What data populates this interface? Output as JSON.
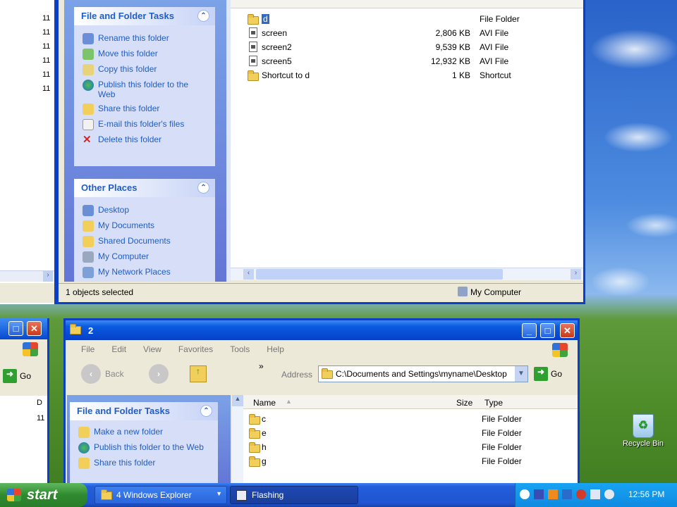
{
  "top_window": {
    "task_pane": {
      "file_folder_tasks": {
        "title": "File and Folder Tasks",
        "items": [
          "Rename this folder",
          "Move this folder",
          "Copy this folder",
          "Publish this folder to the Web",
          "Share this folder",
          "E-mail this folder's files",
          "Delete this folder"
        ]
      },
      "other_places": {
        "title": "Other Places",
        "items": [
          "Desktop",
          "My Documents",
          "Shared Documents",
          "My Computer",
          "My Network Places"
        ]
      }
    },
    "files": [
      {
        "name": "d",
        "size": "",
        "type": "File Folder",
        "icon": "folder-icon",
        "selected": true
      },
      {
        "name": "screen",
        "size": "2,806 KB",
        "type": "AVI File",
        "icon": "avi-file-icon"
      },
      {
        "name": "screen2",
        "size": "9,539 KB",
        "type": "AVI File",
        "icon": "avi-file-icon"
      },
      {
        "name": "screen5",
        "size": "12,932 KB",
        "type": "AVI File",
        "icon": "avi-file-icon"
      },
      {
        "name": "Shortcut to d",
        "size": "1 KB",
        "type": "Shortcut",
        "icon": "shortcut-icon"
      }
    ],
    "status_left": "1 objects selected",
    "status_right": "My Computer"
  },
  "left_window": {
    "numbers": [
      "11",
      "11",
      "11",
      "11",
      "11",
      "11"
    ],
    "go_label": "Go",
    "column_header": "D",
    "row_number": "11"
  },
  "bottom_window": {
    "title": "2",
    "menu": [
      "File",
      "Edit",
      "View",
      "Favorites",
      "Tools",
      "Help"
    ],
    "toolbar": {
      "back": "Back",
      "chevron": "»"
    },
    "address_label": "Address",
    "address_value": "C:\\Documents and Settings\\myname\\Desktop",
    "go_label": "Go",
    "columns": {
      "name": "Name",
      "size": "Size",
      "type": "Type"
    },
    "task_pane": {
      "title": "File and Folder Tasks",
      "items": [
        "Make a new folder",
        "Publish this folder to the Web",
        "Share this folder"
      ]
    },
    "files": [
      {
        "name": "c",
        "type": "File Folder"
      },
      {
        "name": "e",
        "type": "File Folder"
      },
      {
        "name": "h",
        "type": "File Folder"
      },
      {
        "name": "g",
        "type": "File Folder"
      }
    ]
  },
  "desktop": {
    "recycle_bin_label": "Recycle Bin"
  },
  "taskbar": {
    "start_label": "start",
    "buttons": [
      {
        "label": "4 Windows Explorer",
        "active": false
      },
      {
        "label": "Flashing",
        "active": true
      }
    ],
    "clock": "12:56 PM"
  }
}
